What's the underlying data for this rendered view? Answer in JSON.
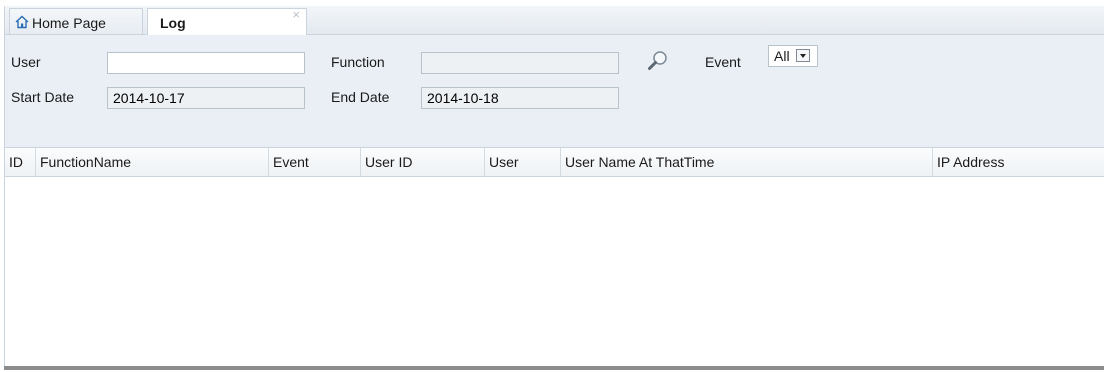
{
  "tabs": {
    "home_label": "Home Page",
    "log_label": "Log",
    "close_glyph": "×"
  },
  "filters": {
    "user_label": "User",
    "user_value": "",
    "function_label": "Function",
    "function_value": "",
    "event_label": "Event",
    "event_selected": "All",
    "start_date_label": "Start Date",
    "start_date_value": "2014-10-17",
    "end_date_label": "End Date",
    "end_date_value": "2014-10-18"
  },
  "table": {
    "columns": [
      "ID",
      "FunctionName",
      "Event",
      "User ID",
      "User",
      "User Name At ThatTime",
      "IP Address"
    ],
    "rows": []
  },
  "icons": {
    "home": "home-icon",
    "close": "close-icon",
    "search": "search-icon",
    "dropdown": "chevron-down-icon"
  },
  "colors": {
    "filter_panel_bg": "#e9eff5",
    "border": "#c9d4de",
    "bottom_bar": "#8c8c8c"
  }
}
